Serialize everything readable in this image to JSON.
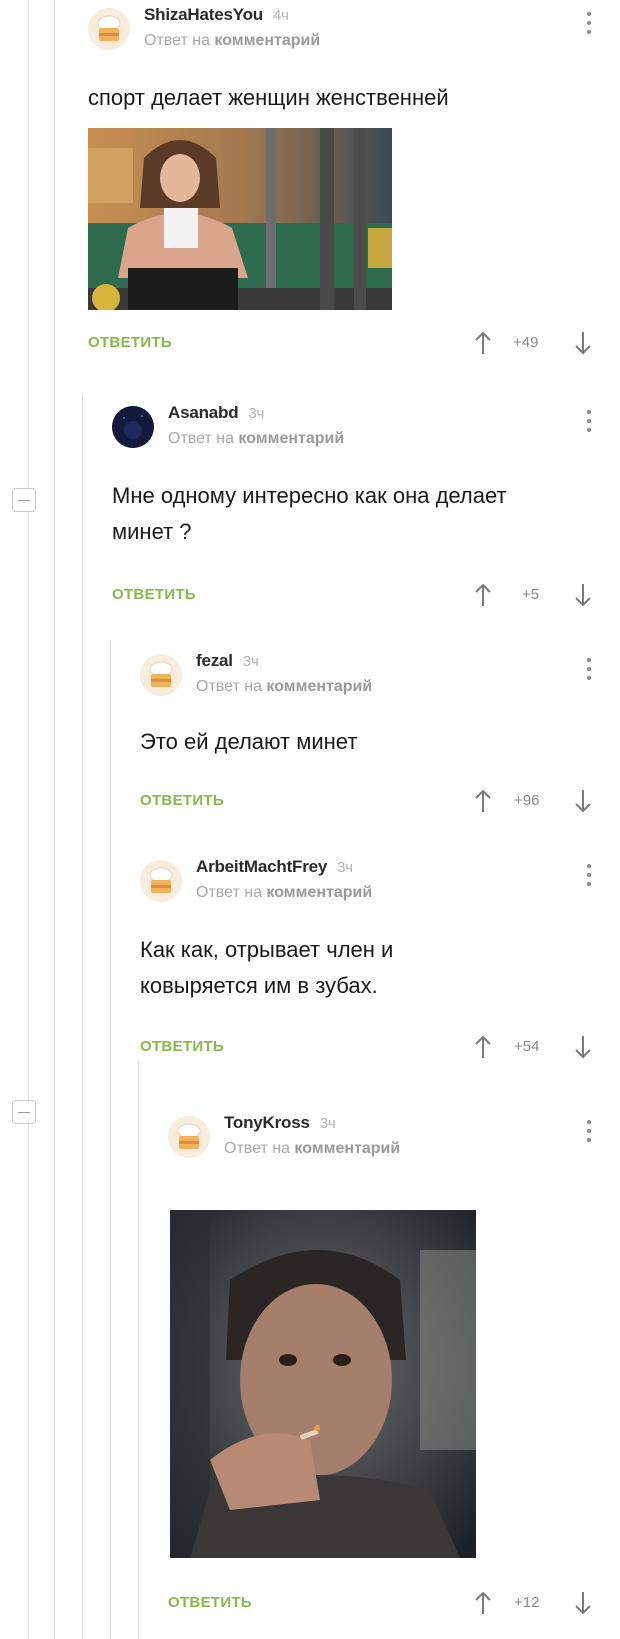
{
  "colors": {
    "accent_green": "#87b94b",
    "meta_gray": "#a8a8a8",
    "thread_line": "#e2e2e2"
  },
  "icons": {
    "avatar_default": "chef-cake-icon",
    "vote_up": "arrow-up-icon",
    "vote_down": "arrow-down-icon",
    "menu": "more-vertical-icon",
    "collapse": "minus-box-icon"
  },
  "comments": [
    {
      "author": "ShizaHatesYou",
      "time": "4ч",
      "reply_prefix": "Ответ на",
      "reply_link": "комментарий",
      "text": "спорт делает женщин женственней",
      "reply_label": "ОТВЕТИТЬ",
      "rating": "+49",
      "image_alt": "photo-muscular-girl-gym"
    },
    {
      "author": "Asanabd",
      "time": "3ч",
      "reply_prefix": "Ответ на",
      "reply_link": "комментарий",
      "text": "Мне одному интересно как она делает минет ?",
      "reply_label": "ОТВЕТИТЬ",
      "rating": "+5"
    },
    {
      "author": "fezal",
      "time": "3ч",
      "reply_prefix": "Ответ на",
      "reply_link": "комментарий",
      "text": "Это ей делают минет",
      "reply_label": "ОТВЕТИТЬ",
      "rating": "+96"
    },
    {
      "author": "ArbeitMachtFrey",
      "time": "3ч",
      "reply_prefix": "Ответ на",
      "reply_link": "комментарий",
      "text": "Как как, отрывает член и ковыряется им в зубах.",
      "reply_label": "ОТВЕТИТЬ",
      "rating": "+54"
    },
    {
      "author": "TonyKross",
      "time": "3ч",
      "reply_prefix": "Ответ на",
      "reply_link": "комментарий",
      "reply_label": "ОТВЕТИТЬ",
      "rating": "+12",
      "image_alt": "photo-man-smoking"
    }
  ]
}
